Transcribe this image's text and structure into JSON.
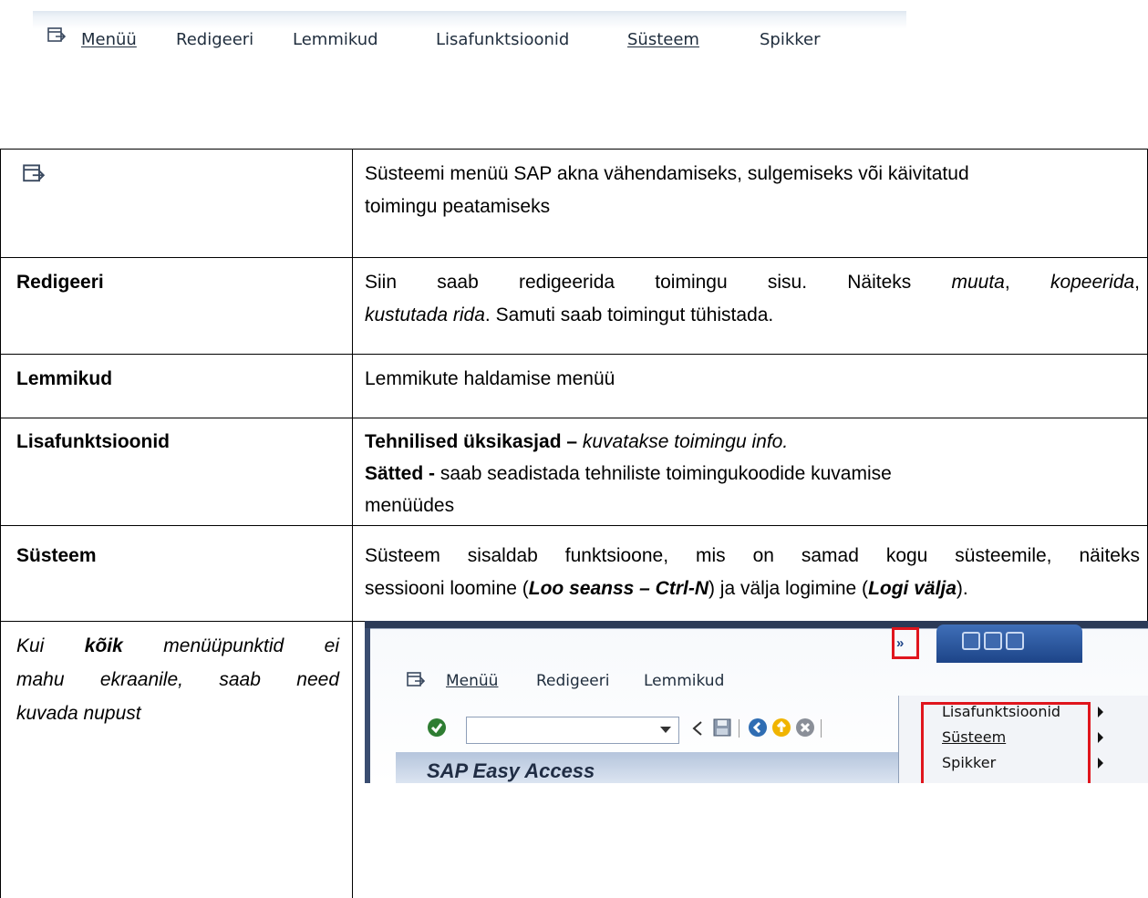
{
  "menubar": {
    "items": [
      "Menüü",
      "Redigeeri",
      "Lemmikud",
      "Lisafunktsioonid",
      "Süsteem",
      "Spikker"
    ]
  },
  "rows": [
    {
      "label": "",
      "desc_lines": [
        "Süsteemi menüü SAP akna vähendamiseks, sulgemiseks või käivitatud",
        "toimingu peatamiseks"
      ]
    },
    {
      "label": "Redigeeri",
      "desc": {
        "line1_a": "Siin saab redigeerida toimingu sisu. Näiteks ",
        "line1_b": "muuta",
        "line1_c": ", ",
        "line1_d": "kopeerida",
        "line1_e": ",",
        "line2_a": "kustutada rida",
        "line2_b": ". Samuti saab toimingut tühistada."
      }
    },
    {
      "label": "Lemmikud",
      "desc": "Lemmikute haldamise menüü"
    },
    {
      "label": "Lisafunktsioonid",
      "desc": {
        "b1": "Tehnilised üksikasjad – ",
        "i1": "kuvatakse toimingu info.",
        "b2": "Sätted - ",
        "t2": " saab seadistada tehniliste toimingukoodide kuvamise",
        "t3": "menüüdes"
      }
    },
    {
      "label": "Süsteem",
      "desc": {
        "l1": "Süsteem sisaldab funktsioone, mis on samad kogu süsteemile, näiteks",
        "l2a": "sessiooni loomine (",
        "l2b": "Loo seanss – Ctrl-N",
        "l2c": ") ja välja logimine (",
        "l2d": "Logi välja",
        "l2e": ")."
      }
    },
    {
      "kui": {
        "a": "Kui ",
        "b": "kõik",
        "c": " menüüpunktid ei",
        "l2": "mahu ekraanile, saab need",
        "l3": "kuvada nupust"
      }
    }
  ],
  "inset": {
    "chevron": "»",
    "menu": [
      "Menüü",
      "Redigeeri",
      "Lemmikud"
    ],
    "banner": "SAP Easy Access",
    "overflow_items": [
      "Lisafunktsioonid",
      "Süsteem",
      "Spikker"
    ]
  }
}
